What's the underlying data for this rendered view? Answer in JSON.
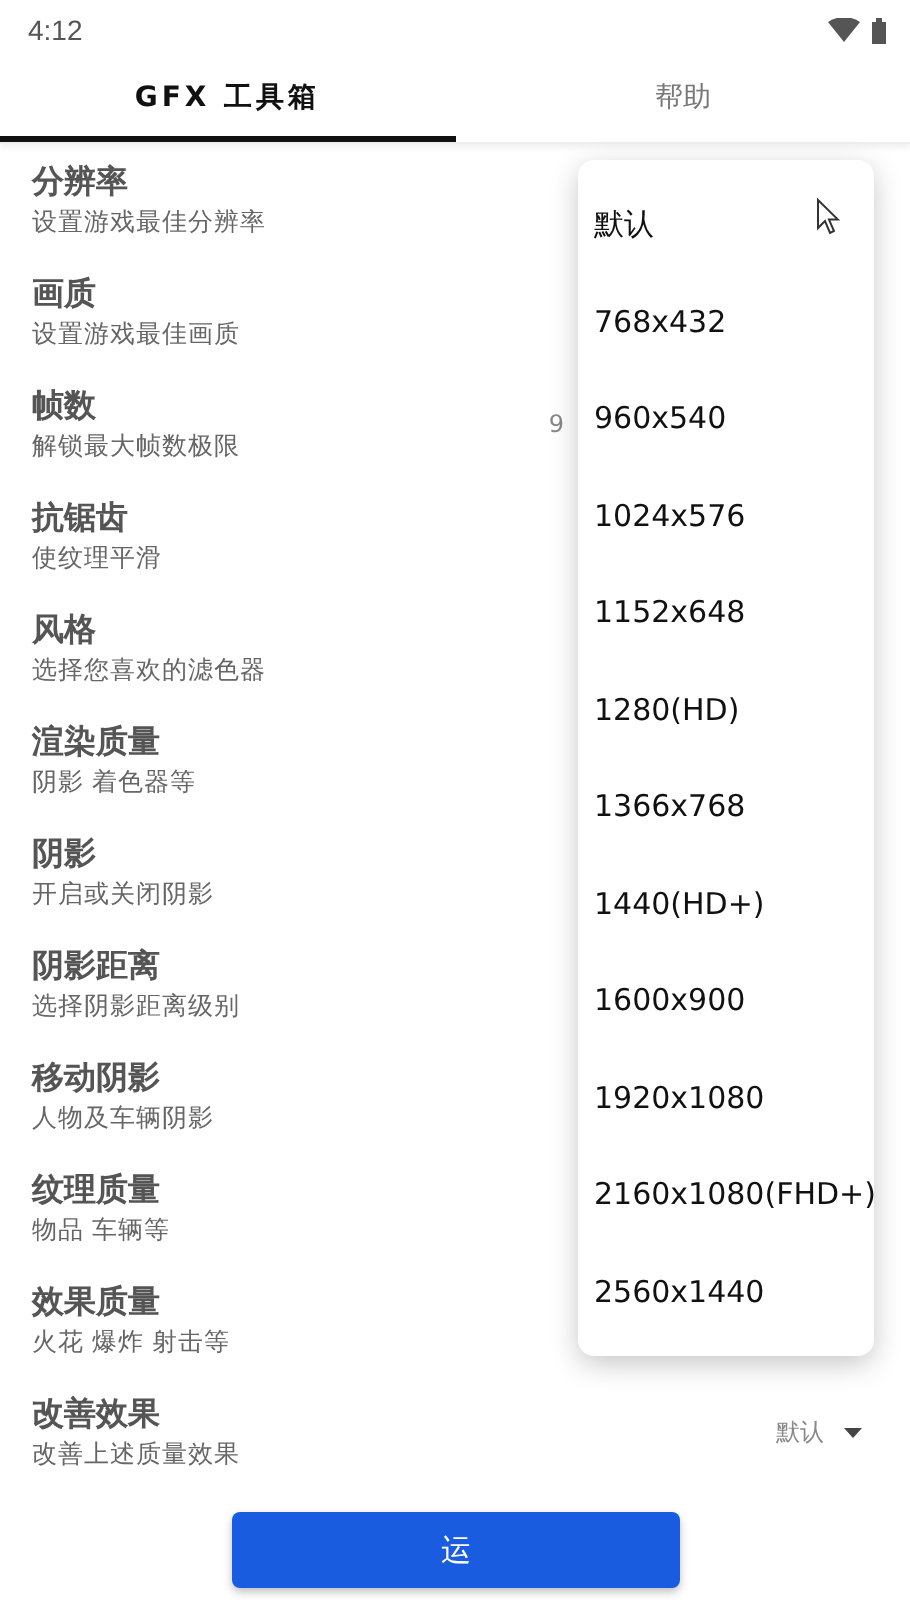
{
  "status_bar": {
    "time": "4:12"
  },
  "tabs": [
    {
      "label": "GFX 工具箱",
      "selected": true
    },
    {
      "label": "帮助",
      "selected": false
    }
  ],
  "settings": [
    {
      "title": "分辨率",
      "subtitle": "设置游戏最佳分辨率"
    },
    {
      "title": "画质",
      "subtitle": "设置游戏最佳画质"
    },
    {
      "title": "帧数",
      "subtitle": "解锁最大帧数极限",
      "value": "9"
    },
    {
      "title": "抗锯齿",
      "subtitle": "使纹理平滑"
    },
    {
      "title": "风格",
      "subtitle": "选择您喜欢的滤色器"
    },
    {
      "title": "渲染质量",
      "subtitle": "阴影 着色器等"
    },
    {
      "title": "阴影",
      "subtitle": "开启或关闭阴影"
    },
    {
      "title": "阴影距离",
      "subtitle": "选择阴影距离级别"
    },
    {
      "title": "移动阴影",
      "subtitle": "人物及车辆阴影"
    },
    {
      "title": "纹理质量",
      "subtitle": "物品 车辆等"
    },
    {
      "title": "效果质量",
      "subtitle": "火花 爆炸 射击等"
    },
    {
      "title": "改善效果",
      "subtitle": "改善上述质量效果",
      "value": "默认"
    }
  ],
  "dropdown": {
    "options": [
      "默认",
      "768x432",
      "960x540",
      "1024x576",
      "1152x648",
      "1280(HD)",
      "1366x768",
      "1440(HD+)",
      "1600x900",
      "1920x1080",
      "2160x1080(FHD+)",
      "2560x1440"
    ]
  },
  "run_button": {
    "label": "运"
  }
}
